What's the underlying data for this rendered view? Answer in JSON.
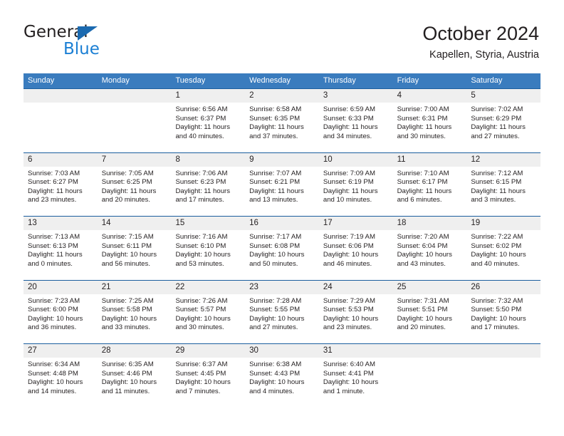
{
  "brand": {
    "name_top": "General",
    "name_bottom": "Blue",
    "triangle_color": "#1b6ab0",
    "blue_text_color": "#1b7fd4"
  },
  "header": {
    "title": "October 2024",
    "subtitle": "Kapellen, Styria, Austria"
  },
  "theme": {
    "header_row_bg": "#3a7cbe",
    "header_row_text": "#ffffff",
    "row_separator": "#1b5e9e",
    "date_band_bg": "#efefef",
    "body_text": "#231f20"
  },
  "weekdays": [
    "Sunday",
    "Monday",
    "Tuesday",
    "Wednesday",
    "Thursday",
    "Friday",
    "Saturday"
  ],
  "weeks": [
    [
      {
        "day": "",
        "lines": []
      },
      {
        "day": "",
        "lines": []
      },
      {
        "day": "1",
        "lines": [
          "Sunrise: 6:56 AM",
          "Sunset: 6:37 PM",
          "Daylight: 11 hours",
          "and 40 minutes."
        ]
      },
      {
        "day": "2",
        "lines": [
          "Sunrise: 6:58 AM",
          "Sunset: 6:35 PM",
          "Daylight: 11 hours",
          "and 37 minutes."
        ]
      },
      {
        "day": "3",
        "lines": [
          "Sunrise: 6:59 AM",
          "Sunset: 6:33 PM",
          "Daylight: 11 hours",
          "and 34 minutes."
        ]
      },
      {
        "day": "4",
        "lines": [
          "Sunrise: 7:00 AM",
          "Sunset: 6:31 PM",
          "Daylight: 11 hours",
          "and 30 minutes."
        ]
      },
      {
        "day": "5",
        "lines": [
          "Sunrise: 7:02 AM",
          "Sunset: 6:29 PM",
          "Daylight: 11 hours",
          "and 27 minutes."
        ]
      }
    ],
    [
      {
        "day": "6",
        "lines": [
          "Sunrise: 7:03 AM",
          "Sunset: 6:27 PM",
          "Daylight: 11 hours",
          "and 23 minutes."
        ]
      },
      {
        "day": "7",
        "lines": [
          "Sunrise: 7:05 AM",
          "Sunset: 6:25 PM",
          "Daylight: 11 hours",
          "and 20 minutes."
        ]
      },
      {
        "day": "8",
        "lines": [
          "Sunrise: 7:06 AM",
          "Sunset: 6:23 PM",
          "Daylight: 11 hours",
          "and 17 minutes."
        ]
      },
      {
        "day": "9",
        "lines": [
          "Sunrise: 7:07 AM",
          "Sunset: 6:21 PM",
          "Daylight: 11 hours",
          "and 13 minutes."
        ]
      },
      {
        "day": "10",
        "lines": [
          "Sunrise: 7:09 AM",
          "Sunset: 6:19 PM",
          "Daylight: 11 hours",
          "and 10 minutes."
        ]
      },
      {
        "day": "11",
        "lines": [
          "Sunrise: 7:10 AM",
          "Sunset: 6:17 PM",
          "Daylight: 11 hours",
          "and 6 minutes."
        ]
      },
      {
        "day": "12",
        "lines": [
          "Sunrise: 7:12 AM",
          "Sunset: 6:15 PM",
          "Daylight: 11 hours",
          "and 3 minutes."
        ]
      }
    ],
    [
      {
        "day": "13",
        "lines": [
          "Sunrise: 7:13 AM",
          "Sunset: 6:13 PM",
          "Daylight: 11 hours",
          "and 0 minutes."
        ]
      },
      {
        "day": "14",
        "lines": [
          "Sunrise: 7:15 AM",
          "Sunset: 6:11 PM",
          "Daylight: 10 hours",
          "and 56 minutes."
        ]
      },
      {
        "day": "15",
        "lines": [
          "Sunrise: 7:16 AM",
          "Sunset: 6:10 PM",
          "Daylight: 10 hours",
          "and 53 minutes."
        ]
      },
      {
        "day": "16",
        "lines": [
          "Sunrise: 7:17 AM",
          "Sunset: 6:08 PM",
          "Daylight: 10 hours",
          "and 50 minutes."
        ]
      },
      {
        "day": "17",
        "lines": [
          "Sunrise: 7:19 AM",
          "Sunset: 6:06 PM",
          "Daylight: 10 hours",
          "and 46 minutes."
        ]
      },
      {
        "day": "18",
        "lines": [
          "Sunrise: 7:20 AM",
          "Sunset: 6:04 PM",
          "Daylight: 10 hours",
          "and 43 minutes."
        ]
      },
      {
        "day": "19",
        "lines": [
          "Sunrise: 7:22 AM",
          "Sunset: 6:02 PM",
          "Daylight: 10 hours",
          "and 40 minutes."
        ]
      }
    ],
    [
      {
        "day": "20",
        "lines": [
          "Sunrise: 7:23 AM",
          "Sunset: 6:00 PM",
          "Daylight: 10 hours",
          "and 36 minutes."
        ]
      },
      {
        "day": "21",
        "lines": [
          "Sunrise: 7:25 AM",
          "Sunset: 5:58 PM",
          "Daylight: 10 hours",
          "and 33 minutes."
        ]
      },
      {
        "day": "22",
        "lines": [
          "Sunrise: 7:26 AM",
          "Sunset: 5:57 PM",
          "Daylight: 10 hours",
          "and 30 minutes."
        ]
      },
      {
        "day": "23",
        "lines": [
          "Sunrise: 7:28 AM",
          "Sunset: 5:55 PM",
          "Daylight: 10 hours",
          "and 27 minutes."
        ]
      },
      {
        "day": "24",
        "lines": [
          "Sunrise: 7:29 AM",
          "Sunset: 5:53 PM",
          "Daylight: 10 hours",
          "and 23 minutes."
        ]
      },
      {
        "day": "25",
        "lines": [
          "Sunrise: 7:31 AM",
          "Sunset: 5:51 PM",
          "Daylight: 10 hours",
          "and 20 minutes."
        ]
      },
      {
        "day": "26",
        "lines": [
          "Sunrise: 7:32 AM",
          "Sunset: 5:50 PM",
          "Daylight: 10 hours",
          "and 17 minutes."
        ]
      }
    ],
    [
      {
        "day": "27",
        "lines": [
          "Sunrise: 6:34 AM",
          "Sunset: 4:48 PM",
          "Daylight: 10 hours",
          "and 14 minutes."
        ]
      },
      {
        "day": "28",
        "lines": [
          "Sunrise: 6:35 AM",
          "Sunset: 4:46 PM",
          "Daylight: 10 hours",
          "and 11 minutes."
        ]
      },
      {
        "day": "29",
        "lines": [
          "Sunrise: 6:37 AM",
          "Sunset: 4:45 PM",
          "Daylight: 10 hours",
          "and 7 minutes."
        ]
      },
      {
        "day": "30",
        "lines": [
          "Sunrise: 6:38 AM",
          "Sunset: 4:43 PM",
          "Daylight: 10 hours",
          "and 4 minutes."
        ]
      },
      {
        "day": "31",
        "lines": [
          "Sunrise: 6:40 AM",
          "Sunset: 4:41 PM",
          "Daylight: 10 hours",
          "and 1 minute."
        ]
      },
      {
        "day": "",
        "lines": []
      },
      {
        "day": "",
        "lines": []
      }
    ]
  ]
}
